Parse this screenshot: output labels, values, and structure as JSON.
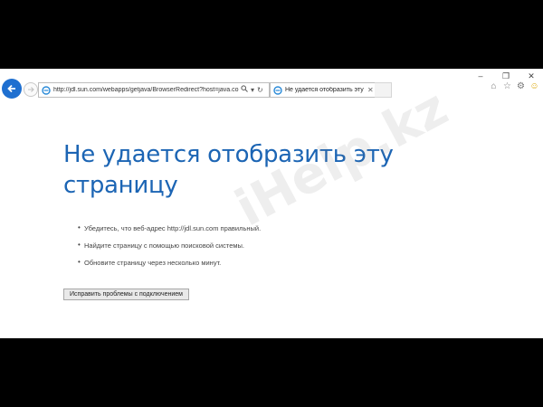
{
  "browser": {
    "window_controls": {
      "minimize": "–",
      "maximize": "❐",
      "close": "✕"
    },
    "address": {
      "url": "http://jdl.sun.com/webapps/getjava/BrowserRedirect?host=java.co",
      "search_icon": "search-icon",
      "refresh_icon": "refresh-icon"
    },
    "tab": {
      "title": "Не удается отобразить эту ...",
      "close": "✕"
    },
    "toolbar_icons": [
      "home-icon",
      "favorites-star-icon",
      "settings-gear-icon",
      "feedback-smiley-icon"
    ]
  },
  "page": {
    "heading": "Не удается отобразить эту страницу",
    "tips": [
      "Убедитесь, что веб-адрес http://jdl.sun.com правильный.",
      "Найдите страницу с помощью поисковой системы.",
      "Обновите страницу через несколько минут."
    ],
    "fix_button": "Исправить проблемы с подключением"
  },
  "watermark": "iHelp.kz",
  "colors": {
    "accent": "#1c65b4",
    "back_button": "#1e6fd0"
  }
}
